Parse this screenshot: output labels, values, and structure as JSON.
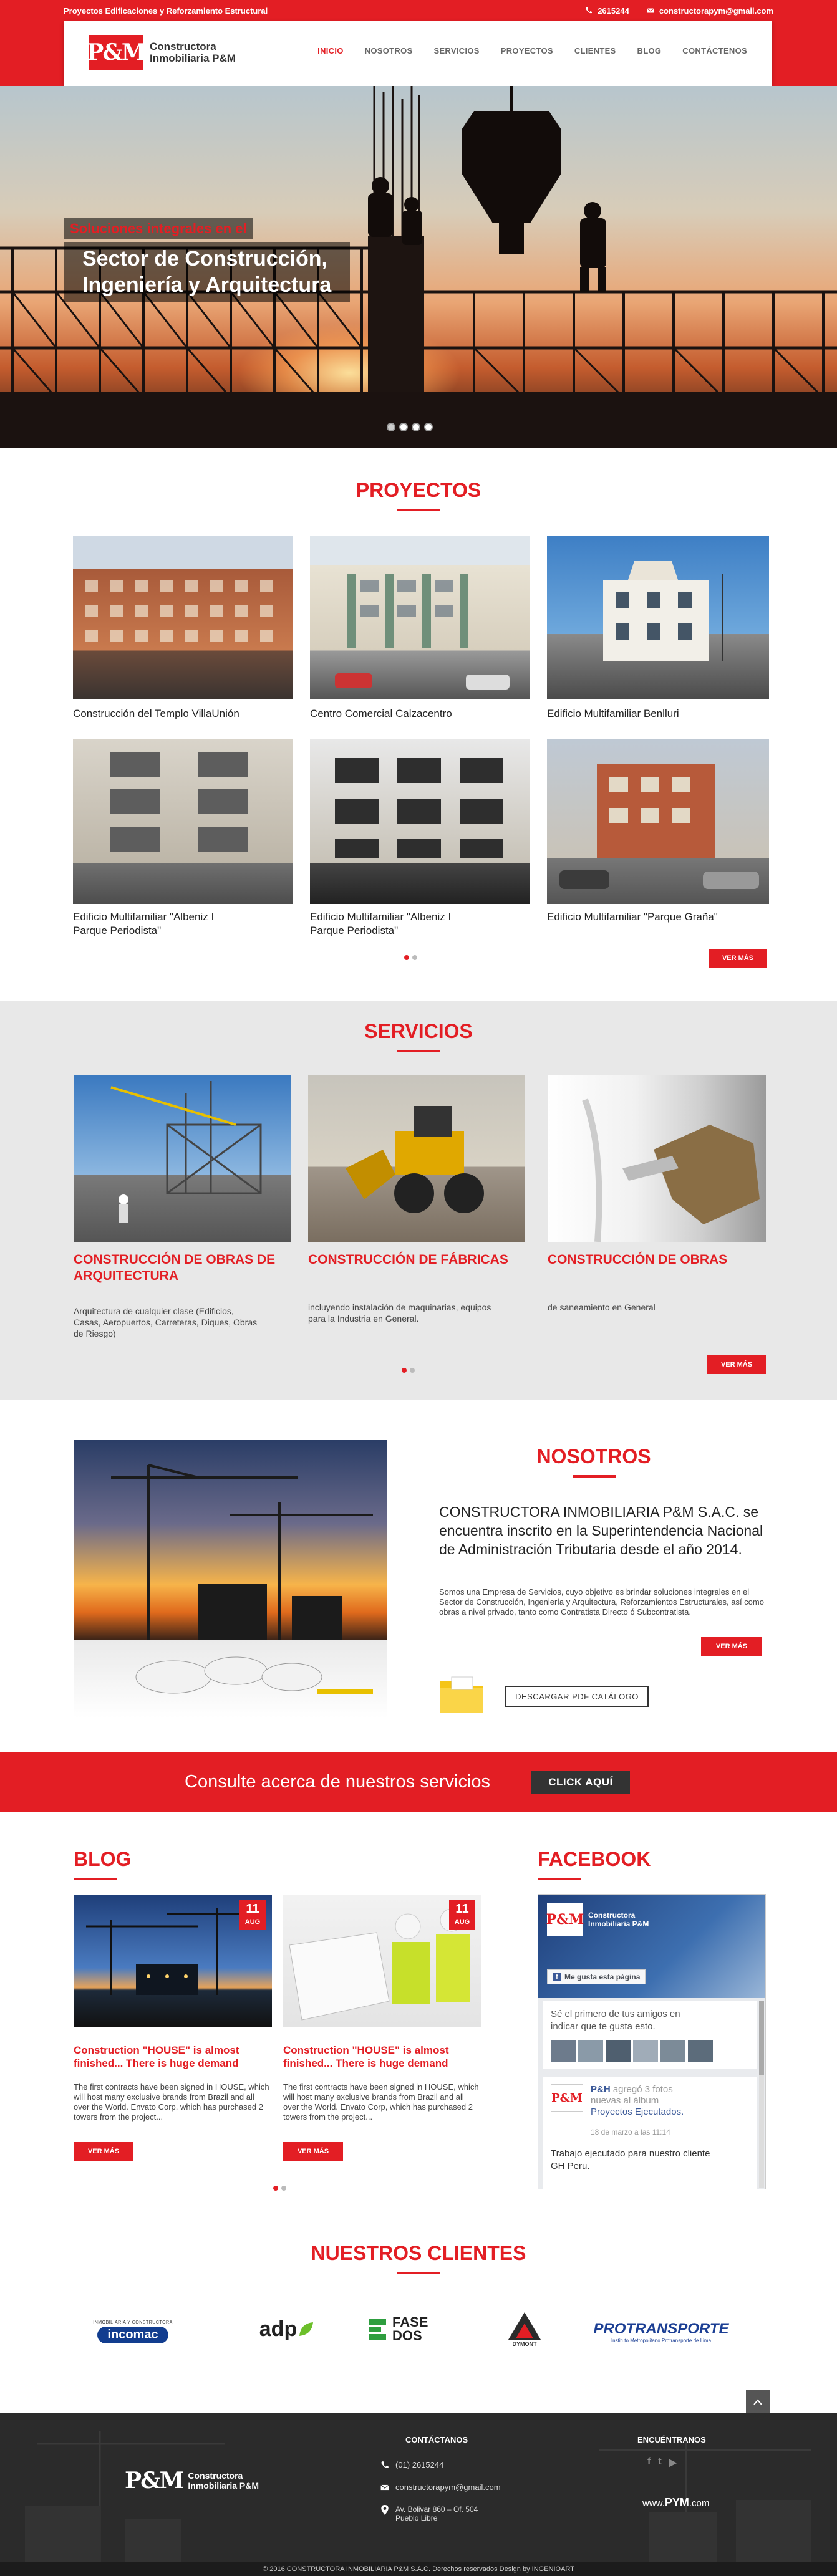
{
  "topbar": {
    "tagline": "Proyectos Edificaciones y Reforzamiento Estructural",
    "phone": "2615244",
    "email": "constructorapym@gmail.com"
  },
  "header": {
    "logo_mark": "P&M",
    "logo_line1": "Constructora",
    "logo_line2": "Inmobiliaria P&M",
    "nav": [
      "INICIO",
      "NOSOTROS",
      "SERVICIOS",
      "PROYECTOS",
      "CLIENTES",
      "BLOG",
      "CONTÁCTENOS"
    ],
    "nav_active": "INICIO"
  },
  "hero": {
    "caption_small": "Soluciones integrales en el",
    "caption_line1": "Sector de Construcción,",
    "caption_line2": "Ingeniería y Arquitectura"
  },
  "proyectos": {
    "title": "PROYECTOS",
    "items": [
      {
        "label": "Construcción del Templo VillaUnión"
      },
      {
        "label": "Centro Comercial Calzacentro"
      },
      {
        "label": "Edificio Multifamiliar Benlluri"
      },
      {
        "label": "Edificio Multifamiliar \"Albeniz I Parque Periodista\""
      },
      {
        "label": "Edificio Multifamiliar \"Albeniz I Parque Periodista\""
      },
      {
        "label": "Edificio Multifamiliar \"Parque Graña\""
      }
    ],
    "more_label": "VER MÁS"
  },
  "servicios": {
    "title": "SERVICIOS",
    "items": [
      {
        "title": "CONSTRUCCIÓN DE OBRAS DE ARQUITECTURA",
        "desc": "Arquitectura de cualquier clase (Edificios, Casas, Aeropuertos, Carreteras, Diques, Obras de Riesgo)"
      },
      {
        "title": "CONSTRUCCIÓN DE FÁBRICAS",
        "desc": "incluyendo instalación de maquinarias, equipos para la Industria en General."
      },
      {
        "title": "CONSTRUCCIÓN DE OBRAS",
        "desc": "de saneamiento en General"
      }
    ],
    "more_label": "VER MÁS"
  },
  "nosotros": {
    "title": "NOSOTROS",
    "lead": "CONSTRUCTORA INMOBILIARIA P&M S.A.C. se encuentra inscrito en la Superintendencia Nacional de Administración Tributaria desde el año 2014.",
    "desc": "Somos una Empresa de Servicios, cuyo objetivo es brindar soluciones integrales en el Sector de Construcción, Ingeniería y Arquitectura, Reforzamientos Estructurales, así como obras a nivel privado, tanto como Contratista Directo ó Subcontratista.",
    "more_label": "VER MÁS",
    "download_label": "DESCARGAR PDF CATÁLOGO"
  },
  "banner": {
    "text": "Consulte acerca de nuestros servicios",
    "button": "CLICK AQUÍ"
  },
  "blog": {
    "title": "BLOG",
    "posts": [
      {
        "day": "11",
        "month": "AUG",
        "title": "Construction \"HOUSE\" is almost finished... There is huge demand",
        "desc": "The first contracts have been signed in HOUSE, which will host many exclusive brands from Brazil and all over the World. Envato Corp, which has purchased 2 towers from the project...",
        "more": "VER MÁS"
      },
      {
        "day": "11",
        "month": "AUG",
        "title": "Construction \"HOUSE\" is almost finished... There is huge demand",
        "desc": "The first contracts have been signed in HOUSE, which will host many exclusive brands from Brazil and all over the World. Envato Corp, which has purchased 2 towers from the project...",
        "more": "VER MÁS"
      }
    ]
  },
  "facebook": {
    "title": "FACEBOOK",
    "page_mark": "P&M",
    "page_line1": "Constructora",
    "page_line2": "Inmobiliaria P&M",
    "like_label": "Me gusta esta página",
    "friends_text": "Sé el primero de tus amigos en indicar que te gusta esto.",
    "post_author": "P&H",
    "post_action": "agregó 3 fotos nuevas al álbum",
    "post_album": "Proyectos Ejecutados.",
    "post_date": "18 de marzo a las 11:14",
    "post_text": "Trabajo ejecutado para nuestro cliente GH Peru."
  },
  "clientes": {
    "title": "NUESTROS CLIENTES",
    "logos": [
      {
        "name": "incomac",
        "caption": "INMOBILIARIA Y CONSTRUCTORA"
      },
      {
        "name": "adp",
        "caption": ""
      },
      {
        "name": "FASE DOS",
        "caption": ""
      },
      {
        "name": "DYMONT",
        "caption": ""
      },
      {
        "name": "PROTRANSPORTE",
        "caption": "Instituto Metropolitano Protransporte de Lima"
      }
    ]
  },
  "footer": {
    "logo_mark": "P&M",
    "logo_line1": "Constructora",
    "logo_line2": "Inmobiliaria P&M",
    "contact_title": "CONTÁCTANOS",
    "phone": "(01) 2615244",
    "email": "constructorapym@gmail.com",
    "address_line1": "Av. Bolivar 860 – Of. 504",
    "address_line2": "Pueblo Libre",
    "find_title": "ENCUÉNTRANOS",
    "website_prefix": "www.",
    "website_domain": "PYM",
    "website_suffix": ".com",
    "copyright": "© 2016  CONSTRUCTORA INMOBILIARIA P&M S.A.C.  Derechos reservados Design by INGENIOART"
  },
  "colors": {
    "brand_red": "#e31e24",
    "dark": "#333333",
    "footer_bg": "#2b2b2b"
  }
}
